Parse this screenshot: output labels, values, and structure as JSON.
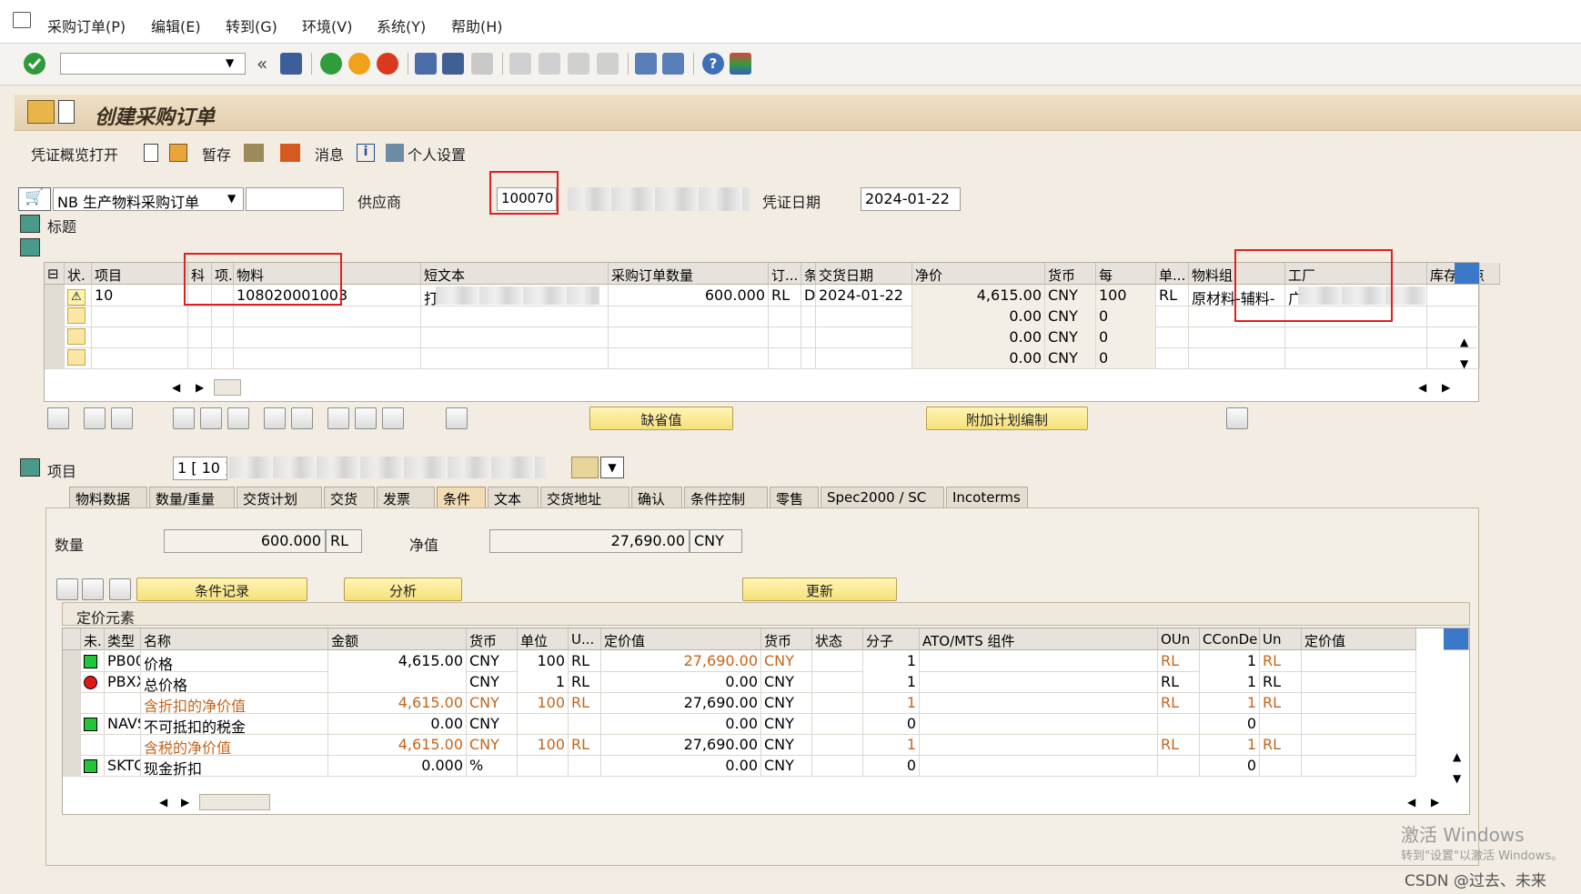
{
  "menu": [
    "采购订单(P)",
    "编辑(E)",
    "转到(G)",
    "环境(V)",
    "系统(Y)",
    "帮助(H)"
  ],
  "title": "创建采购订单",
  "app_toolbar": {
    "overview": "凭证概览打开",
    "hold": "暂存",
    "messages": "消息",
    "personal": "个人设置"
  },
  "header": {
    "doc_type": "NB 生产物料采购订单",
    "vendor_label": "供应商",
    "vendor_value": "100070",
    "doc_date_label": "凭证日期",
    "doc_date_value": "2024-01-22",
    "header_label": "标题"
  },
  "items_grid": {
    "columns": [
      "状.",
      "项目",
      "科",
      "项.",
      "物料",
      "短文本",
      "采购订单数量",
      "订...",
      "交货日期",
      "净价",
      "货币",
      "每",
      "单...",
      "物料组",
      "工厂",
      "库存地点"
    ],
    "rows": [
      {
        "item": "10",
        "material": "108020001003",
        "short_text": "打",
        "qty": "600.000",
        "unit": "RL",
        "cat": "D",
        "date": "2024-01-22",
        "price": "4,615.00",
        "cur": "CNY",
        "per": "100",
        "uom": "RL",
        "mgroup": "原材料-辅料-",
        "plant": "广"
      },
      {
        "item": "",
        "material": "",
        "short_text": "",
        "qty": "",
        "unit": "",
        "cat": "",
        "date": "",
        "price": "0.00",
        "cur": "CNY",
        "per": "0",
        "uom": "",
        "mgroup": "",
        "plant": ""
      },
      {
        "item": "",
        "material": "",
        "short_text": "",
        "qty": "",
        "unit": "",
        "cat": "",
        "date": "",
        "price": "0.00",
        "cur": "CNY",
        "per": "0",
        "uom": "",
        "mgroup": "",
        "plant": ""
      },
      {
        "item": "",
        "material": "",
        "short_text": "",
        "qty": "",
        "unit": "",
        "cat": "",
        "date": "",
        "price": "0.00",
        "cur": "CNY",
        "per": "0",
        "uom": "",
        "mgroup": "",
        "plant": ""
      }
    ]
  },
  "buttons": {
    "default": "缺省值",
    "add_plan": "附加计划编制",
    "cond_record": "条件记录",
    "analysis": "分析",
    "update": "更新"
  },
  "item_detail": {
    "label": "项目",
    "value": "1 [ 10 ]"
  },
  "tabs": [
    "物料数据",
    "数量/重量",
    "交货计划",
    "交货",
    "发票",
    "条件",
    "文本",
    "交货地址",
    "确认",
    "条件控制",
    "零售",
    "Spec2000 / SC",
    "Incoterms"
  ],
  "conditions": {
    "qty_label": "数量",
    "qty_value": "600.000",
    "qty_unit": "RL",
    "net_label": "净值",
    "net_value": "27,690.00",
    "net_cur": "CNY",
    "section_title": "定价元素",
    "columns": [
      "未.",
      "类型",
      "名称",
      "金额",
      "货币",
      "单位",
      "U...",
      "定价值",
      "货币",
      "状态",
      "分子",
      "ATO/MTS 组件",
      "OUn",
      "CConDe",
      "Un",
      "定价值"
    ],
    "rows": [
      {
        "status": "green",
        "type": "PB00",
        "name": "价格",
        "amount": "4,615.00",
        "cur": "CNY",
        "unit": "100",
        "u": "RL",
        "value": "27,690.00",
        "vcur": "CNY",
        "num": "1",
        "oun": "RL",
        "ccd": "1",
        "un": "RL",
        "orange_value": true
      },
      {
        "status": "red",
        "type": "PBXX",
        "name": "总价格",
        "amount": "",
        "cur": "CNY",
        "unit": "1",
        "u": "RL",
        "value": "0.00",
        "vcur": "CNY",
        "num": "1",
        "oun": "RL",
        "ccd": "1",
        "un": "RL",
        "orange_value": false
      },
      {
        "status": "",
        "type": "",
        "name": "含折扣的净价值",
        "amount": "4,615.00",
        "cur": "CNY",
        "unit": "100",
        "u": "RL",
        "value": "27,690.00",
        "vcur": "CNY",
        "num": "1",
        "oun": "RL",
        "ccd": "1",
        "un": "RL",
        "orange_value": false,
        "subtotal": true
      },
      {
        "status": "green",
        "type": "NAVS",
        "name": "不可抵扣的税金",
        "amount": "0.00",
        "cur": "CNY",
        "unit": "",
        "u": "",
        "value": "0.00",
        "vcur": "CNY",
        "num": "0",
        "oun": "",
        "ccd": "0",
        "un": "",
        "orange_value": false
      },
      {
        "status": "",
        "type": "",
        "name": "含税的净价值",
        "amount": "4,615.00",
        "cur": "CNY",
        "unit": "100",
        "u": "RL",
        "value": "27,690.00",
        "vcur": "CNY",
        "num": "1",
        "oun": "RL",
        "ccd": "1",
        "un": "RL",
        "orange_value": false,
        "subtotal": true
      },
      {
        "status": "green",
        "type": "SKTO",
        "name": "现金折扣",
        "amount": "0.000",
        "cur": "%",
        "unit": "",
        "u": "",
        "value": "0.00",
        "vcur": "CNY",
        "num": "0",
        "oun": "",
        "ccd": "0",
        "un": "",
        "orange_value": false
      }
    ]
  },
  "watermark": {
    "line1": "激活 Windows",
    "line2": "转到\"设置\"以激活 Windows。",
    "csdn": "CSDN @过去、未来"
  }
}
